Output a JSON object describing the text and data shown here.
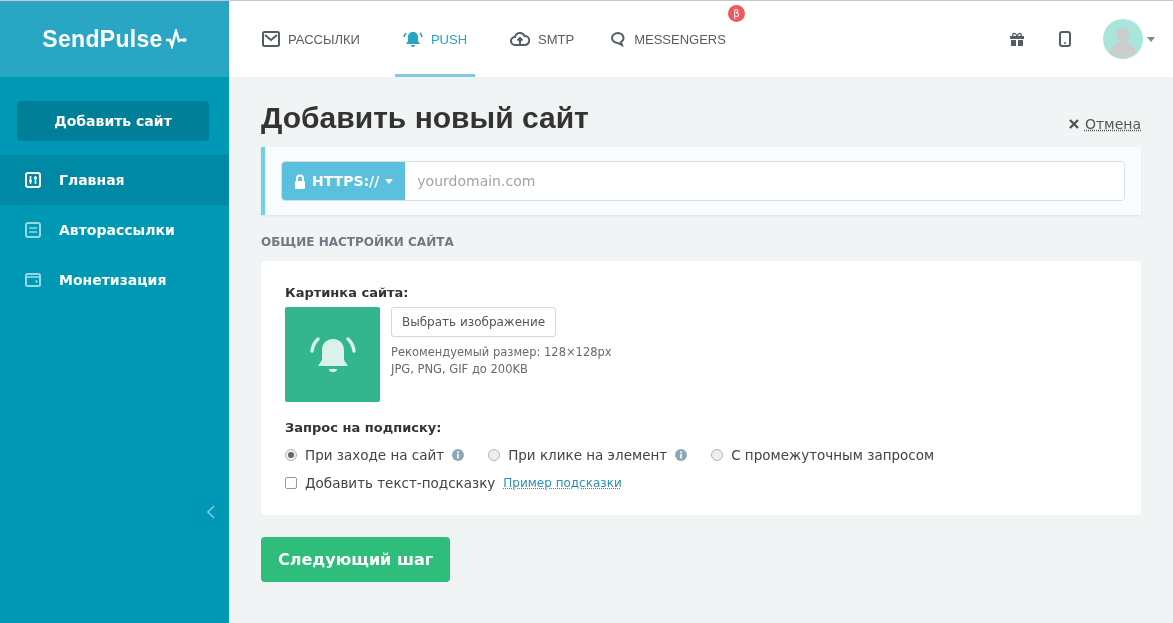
{
  "logo": {
    "text": "SendPulse"
  },
  "nav_tabs": [
    {
      "label": "РАССЫЛКИ",
      "selected": false
    },
    {
      "label": "PUSH",
      "selected": true
    },
    {
      "label": "SMTP",
      "selected": false
    },
    {
      "label": "MESSENGERS",
      "selected": false,
      "badge": "β"
    }
  ],
  "sidebar": {
    "add_button": "Добавить сайт",
    "items": [
      {
        "label": "Главная",
        "selected": true
      },
      {
        "label": "Авторассылки",
        "selected": false
      },
      {
        "label": "Монетизация",
        "selected": false
      }
    ]
  },
  "page_title": "Добавить новый сайт",
  "cancel_link": "Отмена",
  "url_field": {
    "protocol": "HTTPS://",
    "placeholder": "yourdomain.com"
  },
  "section_heading": "ОБЩИЕ НАСТРОЙКИ САЙТА",
  "site_image": {
    "label": "Картинка сайта:",
    "button": "Выбрать изображение",
    "hints": [
      "Рекомендуемый размер: 128×128px",
      "JPG, PNG, GIF до 200KB"
    ]
  },
  "subscription": {
    "label": "Запрос на подписку:",
    "options": [
      {
        "label": "При заходе на сайт",
        "selected": true,
        "info": true
      },
      {
        "label": "При клике на элемент",
        "selected": false,
        "info": true
      },
      {
        "label": "С промежуточным запросом",
        "selected": false,
        "info": false
      }
    ],
    "hint_checkbox": {
      "label": "Добавить текст-подсказку",
      "checked": false,
      "link": "Пример подсказки"
    }
  },
  "next_button": "Следующий шаг"
}
